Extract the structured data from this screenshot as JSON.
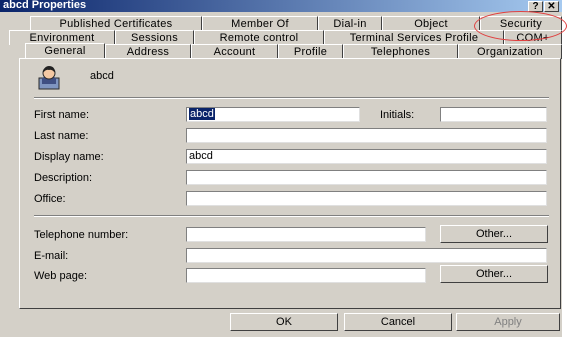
{
  "window": {
    "title": "abcd Properties",
    "help_button": "?",
    "close_button": "✕"
  },
  "tabs": {
    "row1": [
      "Published Certificates",
      "Member Of",
      "Dial-in",
      "Object",
      "Security"
    ],
    "row2": [
      "Environment",
      "Sessions",
      "Remote control",
      "Terminal Services Profile",
      "COM+"
    ],
    "row3": [
      "General",
      "Address",
      "Account",
      "Profile",
      "Telephones",
      "Organization"
    ],
    "active": "General",
    "highlighted": "Security"
  },
  "general": {
    "user_name": "abcd",
    "first_name_label": "First name:",
    "first_name_value": "abcd",
    "initials_label": "Initials:",
    "initials_value": "",
    "last_name_label": "Last name:",
    "last_name_value": "",
    "display_name_label": "Display name:",
    "display_name_value": "abcd",
    "description_label": "Description:",
    "description_value": "",
    "office_label": "Office:",
    "office_value": "",
    "telephone_label": "Telephone number:",
    "telephone_value": "",
    "telephone_other": "Other...",
    "email_label": "E-mail:",
    "email_value": "",
    "webpage_label": "Web page:",
    "webpage_value": "",
    "webpage_other": "Other..."
  },
  "footer": {
    "ok_label": "OK",
    "cancel_label": "Cancel",
    "apply_label": "Apply"
  }
}
